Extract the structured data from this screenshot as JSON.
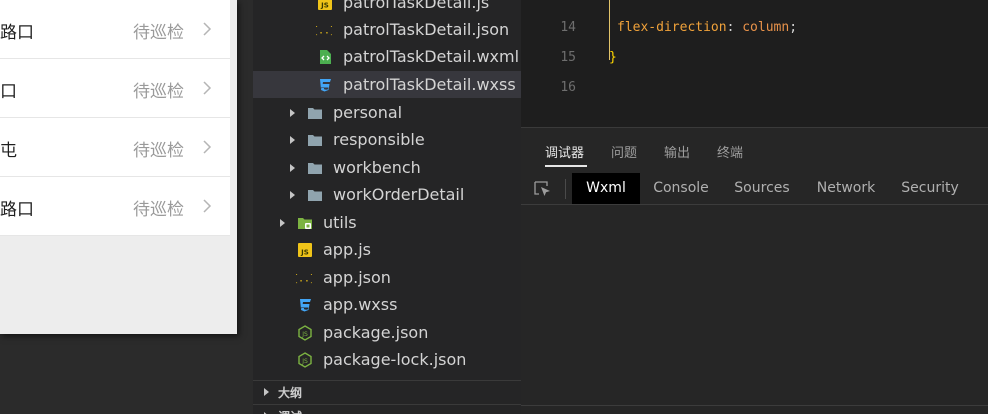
{
  "simulator": {
    "tasks": [
      {
        "name": "路口",
        "status": "待巡检"
      },
      {
        "name": "口",
        "status": "待巡检"
      },
      {
        "name": "屯",
        "status": "待巡检"
      },
      {
        "name": "路口",
        "status": "待巡检"
      }
    ]
  },
  "explorer": {
    "files_top": [
      {
        "label": "patrolTaskDetail.js",
        "icon": "js-file-icon"
      },
      {
        "label": "patrolTaskDetail.json",
        "icon": "json-file-icon"
      },
      {
        "label": "patrolTaskDetail.wxml",
        "icon": "wxml-file-icon"
      },
      {
        "label": "patrolTaskDetail.wxss",
        "icon": "css-file-icon"
      }
    ],
    "folders": [
      {
        "label": "personal"
      },
      {
        "label": "responsible"
      },
      {
        "label": "workbench"
      },
      {
        "label": "workOrderDetail"
      }
    ],
    "utils": {
      "label": "utils"
    },
    "root_files": [
      {
        "label": "app.js",
        "icon": "js-file-icon"
      },
      {
        "label": "app.json",
        "icon": "json-file-icon"
      },
      {
        "label": "app.wxss",
        "icon": "css-file-icon"
      },
      {
        "label": "package.json",
        "icon": "node-file-icon"
      },
      {
        "label": "package-lock.json",
        "icon": "node-file-icon"
      }
    ],
    "sections": [
      {
        "label": "大纲"
      },
      {
        "label": "调试"
      }
    ]
  },
  "editor": {
    "lines": [
      {
        "num": "14",
        "prop": "flex-direction",
        "colon": ": ",
        "value": "column",
        "semi": ";"
      },
      {
        "num": "15",
        "brace": "}"
      },
      {
        "num": "16"
      }
    ]
  },
  "debugger": {
    "tabs": [
      {
        "label": "调试器"
      },
      {
        "label": "问题"
      },
      {
        "label": "输出"
      },
      {
        "label": "终端"
      }
    ],
    "devtools_tabs": [
      {
        "label": "Wxml"
      },
      {
        "label": "Console"
      },
      {
        "label": "Sources"
      },
      {
        "label": "Network"
      },
      {
        "label": "Security"
      }
    ]
  }
}
